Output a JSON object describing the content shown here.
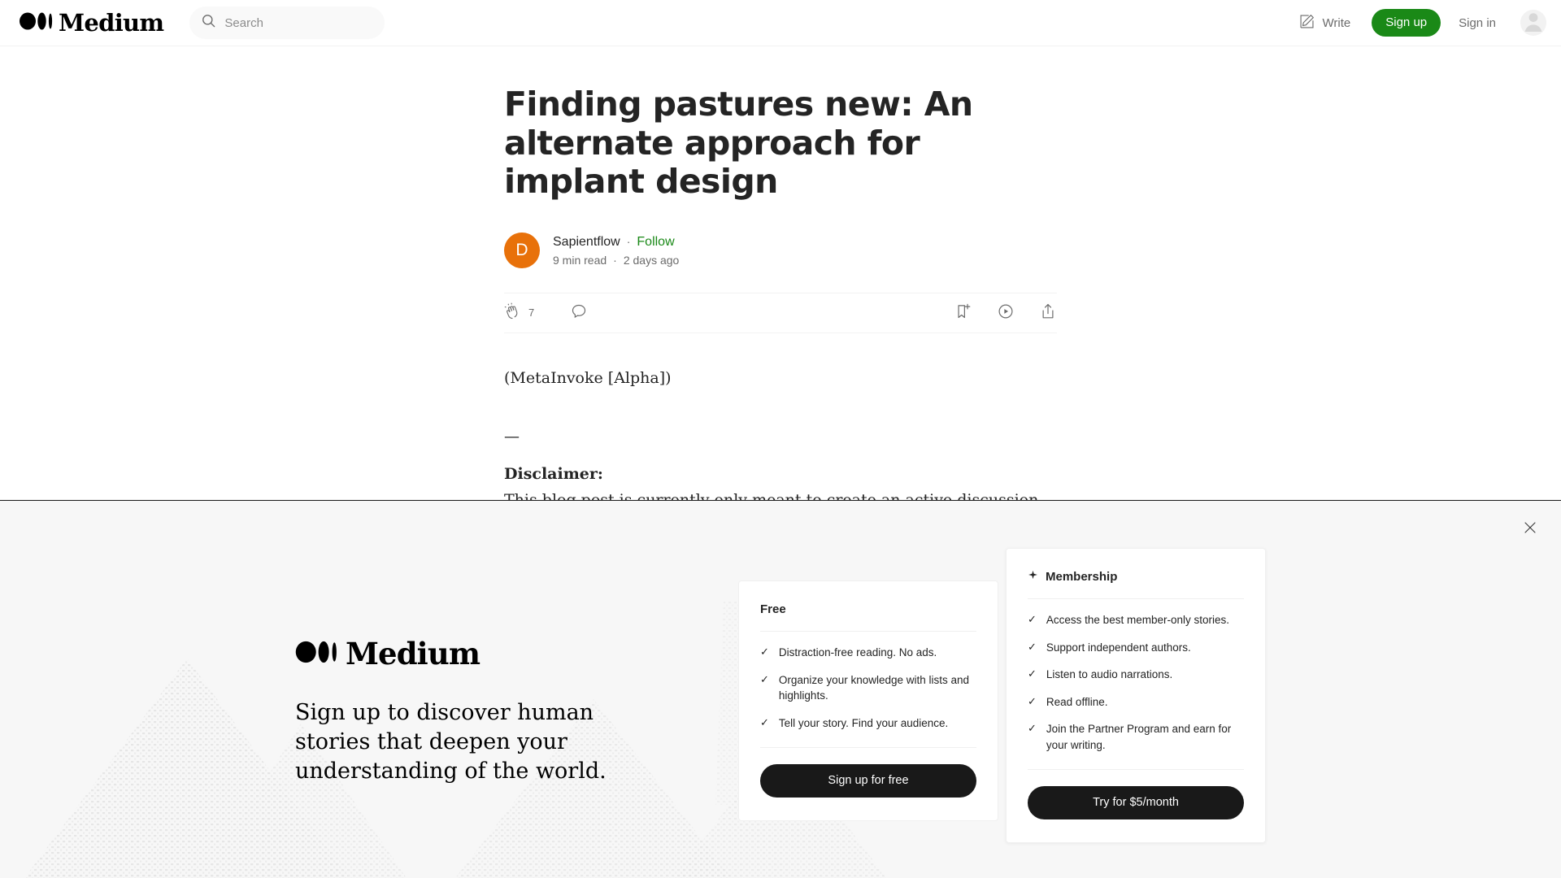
{
  "header": {
    "logo_text": "Medium",
    "logo_icon": "medium-logo-icon",
    "search": {
      "placeholder": "Search",
      "value": ""
    },
    "write_label": "Write",
    "write_icon": "pencil-square-icon",
    "signup_label": "Sign up",
    "signin_label": "Sign in",
    "avatar_icon": "user-avatar-icon",
    "accent_green": "#1a8917"
  },
  "article": {
    "title": "Finding pastures new: An alternate approach for implant design",
    "author": {
      "avatar_letter": "D",
      "avatar_color": "#e8710a",
      "name": "Sapientflow",
      "separator": "·",
      "follow_label": "Follow",
      "read_time": "9 min read",
      "published": "2 days ago"
    },
    "actions": {
      "clap_icon": "clap-icon",
      "clap_count": "7",
      "comment_icon": "comment-icon",
      "bookmark_icon": "bookmark-add-icon",
      "listen_icon": "play-circle-icon",
      "share_icon": "share-icon"
    },
    "body": {
      "meta_line": "(MetaInvoke [Alpha])",
      "separator": "—",
      "disclaimer_heading": "Disclaimer:",
      "disclaimer_text": "This blog post is currently only meant to create an active discussion about the overarching concept as well as its effectiveness in the field whilst the"
    }
  },
  "banner": {
    "close_icon": "close-icon",
    "logo_text": "Medium",
    "logo_icon": "medium-logo-icon",
    "headline": "Sign up to discover human stories that deepen your understanding of the world.",
    "cards": [
      {
        "id": "free",
        "title": "Free",
        "icon": null,
        "features": [
          "Distraction-free reading. No ads.",
          "Organize your knowledge with lists and highlights.",
          "Tell your story. Find your audience."
        ],
        "cta": "Sign up for free"
      },
      {
        "id": "membership",
        "title": "Membership",
        "icon": "sparkle-icon",
        "features": [
          "Access the best member-only stories.",
          "Support independent authors.",
          "Listen to audio narrations.",
          "Read offline.",
          "Join the Partner Program and earn for your writing."
        ],
        "cta": "Try for $5/month"
      }
    ],
    "check_glyph": "✓",
    "background_color": "#f7f7f7"
  }
}
